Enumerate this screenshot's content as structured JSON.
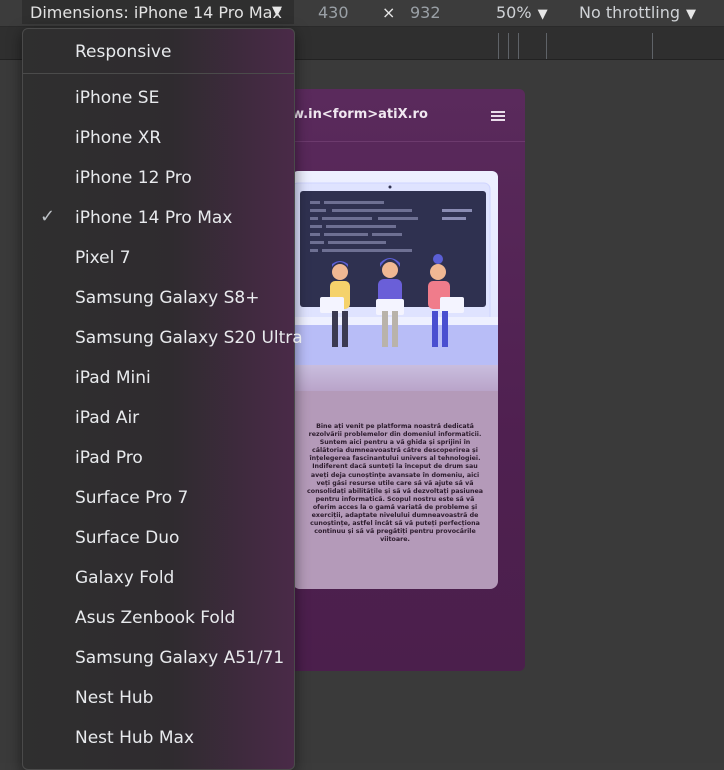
{
  "toolbar": {
    "dimensions_label": "Dimensions: iPhone 14 Pro Max",
    "width_value": "430",
    "times": "×",
    "height_value": "932",
    "zoom": "50%",
    "throttling": "No throttling"
  },
  "menu": {
    "responsive": "Responsive",
    "devices": [
      {
        "label": "iPhone SE",
        "checked": false
      },
      {
        "label": "iPhone XR",
        "checked": false
      },
      {
        "label": "iPhone 12 Pro",
        "checked": false
      },
      {
        "label": "iPhone 14 Pro Max",
        "checked": true
      },
      {
        "label": "Pixel 7",
        "checked": false
      },
      {
        "label": "Samsung Galaxy S8+",
        "checked": false
      },
      {
        "label": "Samsung Galaxy S20 Ultra",
        "checked": false
      },
      {
        "label": "iPad Mini",
        "checked": false
      },
      {
        "label": "iPad Air",
        "checked": false
      },
      {
        "label": "iPad Pro",
        "checked": false
      },
      {
        "label": "Surface Pro 7",
        "checked": false
      },
      {
        "label": "Surface Duo",
        "checked": false
      },
      {
        "label": "Galaxy Fold",
        "checked": false
      },
      {
        "label": "Asus Zenbook Fold",
        "checked": false
      },
      {
        "label": "Samsung Galaxy A51/71",
        "checked": false
      },
      {
        "label": "Nest Hub",
        "checked": false
      },
      {
        "label": "Nest Hub Max",
        "checked": false
      }
    ]
  },
  "page": {
    "site_title": "w.in<form>atiX.ro",
    "intro": "Bine ați venit pe platforma noastră dedicată rezolvării problemelor din domeniul informaticii. Suntem aici pentru a vă ghida și sprijini în călătoria dumneavoastră către descoperirea și înțelegerea fascinantului univers al tehnologiei. Indiferent dacă sunteți la început de drum sau aveți deja cunoștințe avansate în domeniu, aici veți găsi resurse utile care să vă ajute să vă consolidați abilitățile și să vă dezvoltați pasiunea pentru informatică. Scopul nostru este să vă oferim acces la o gamă variată de probleme și exerciții, adaptate nivelului dumneavoastră de cunoștințe, astfel încât să vă puteți perfecționa continuu și să vă pregătiți pentru provocările viitoare."
  },
  "colors": {
    "phone_bg": "#5a2a5c",
    "card_bg": "#b49ab9"
  }
}
